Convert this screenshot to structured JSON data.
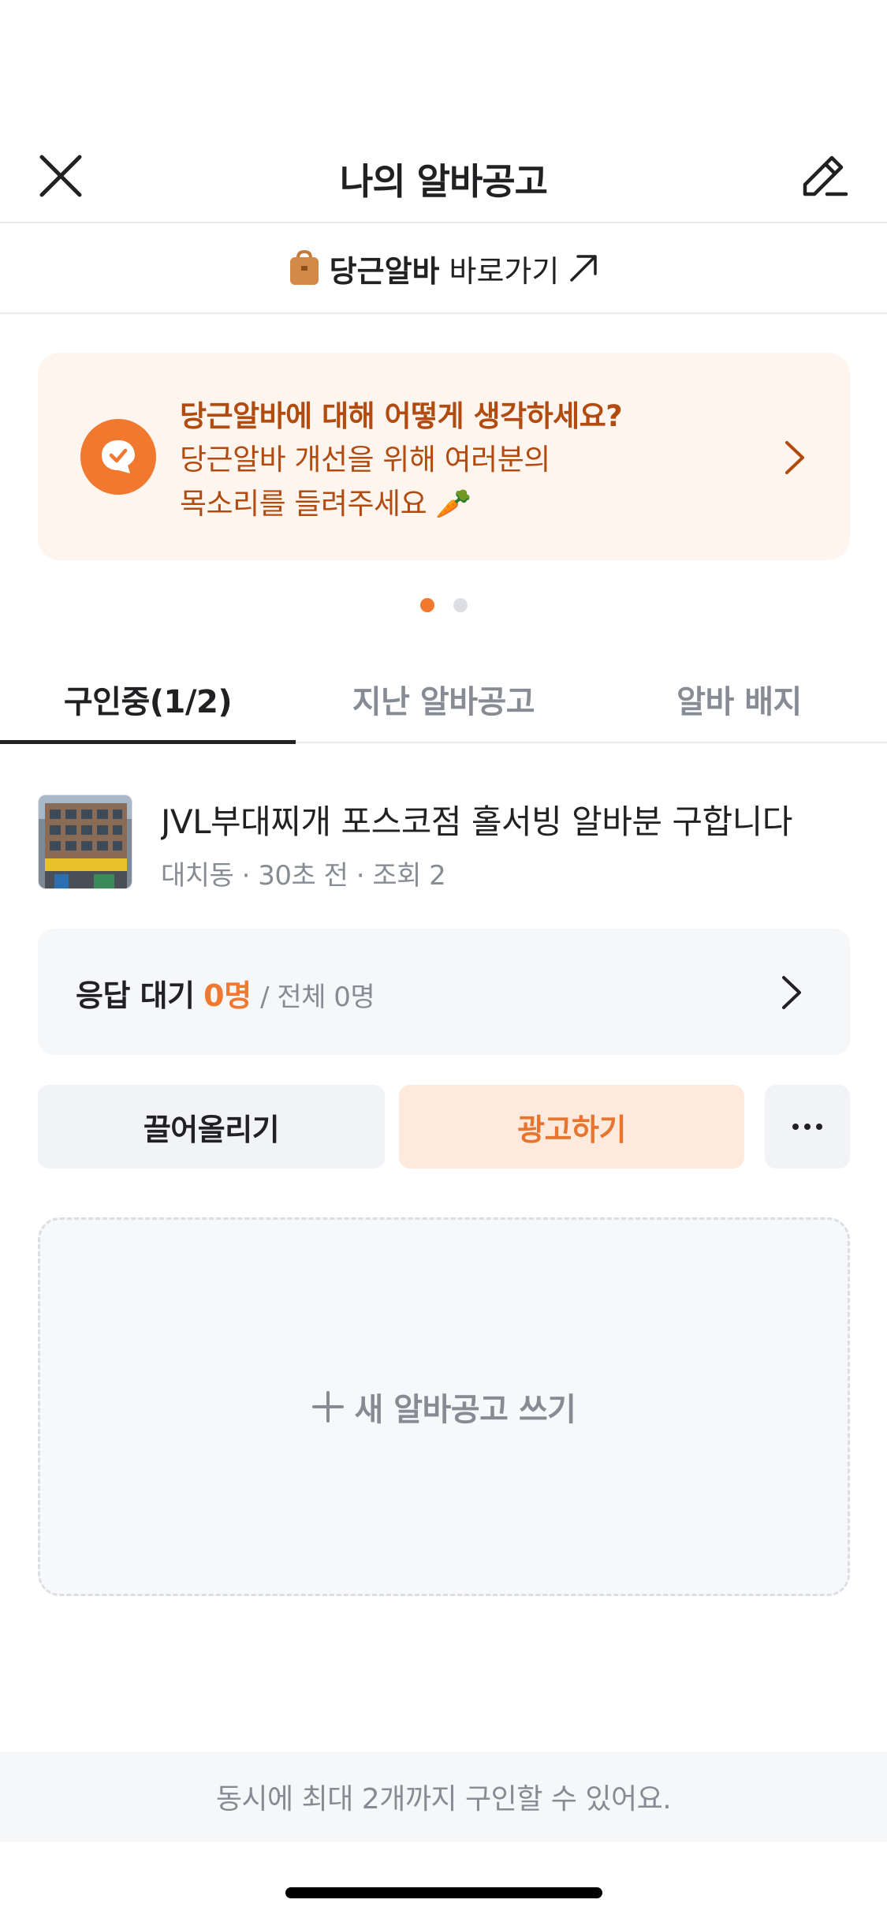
{
  "header": {
    "title": "나의 알바공고"
  },
  "shortcut": {
    "brand": "당근알바",
    "label": "바로가기"
  },
  "banner": {
    "title": "당근알바에 대해 어떻게 생각하세요?",
    "desc_line1": "당근알바 개선을 위해 여러분의",
    "desc_line2": "목소리를 들려주세요 🥕"
  },
  "pagination": {
    "current": 1,
    "total": 2
  },
  "tabs": [
    {
      "label": "구인중(1/2)",
      "active": true
    },
    {
      "label": "지난 알바공고",
      "active": false
    },
    {
      "label": "알바 배지",
      "active": false
    }
  ],
  "post": {
    "title": "JVL부대찌개 포스코점 홀서빙 알바분 구합니다",
    "meta": "대치동 · 30초 전 · 조회 2"
  },
  "response": {
    "label": "응답 대기",
    "count": "0명",
    "total": "/ 전체 0명"
  },
  "buttons": {
    "bump": "끌어올리기",
    "ad": "광고하기",
    "more": "···"
  },
  "new_post": {
    "label": "새 알바공고 쓰기"
  },
  "notice": "동시에 최대 2개까지 구인할 수 있어요.",
  "colors": {
    "accent": "#f0782f",
    "banner_text": "#b14b10",
    "banner_bg": "#fdf5ee"
  }
}
